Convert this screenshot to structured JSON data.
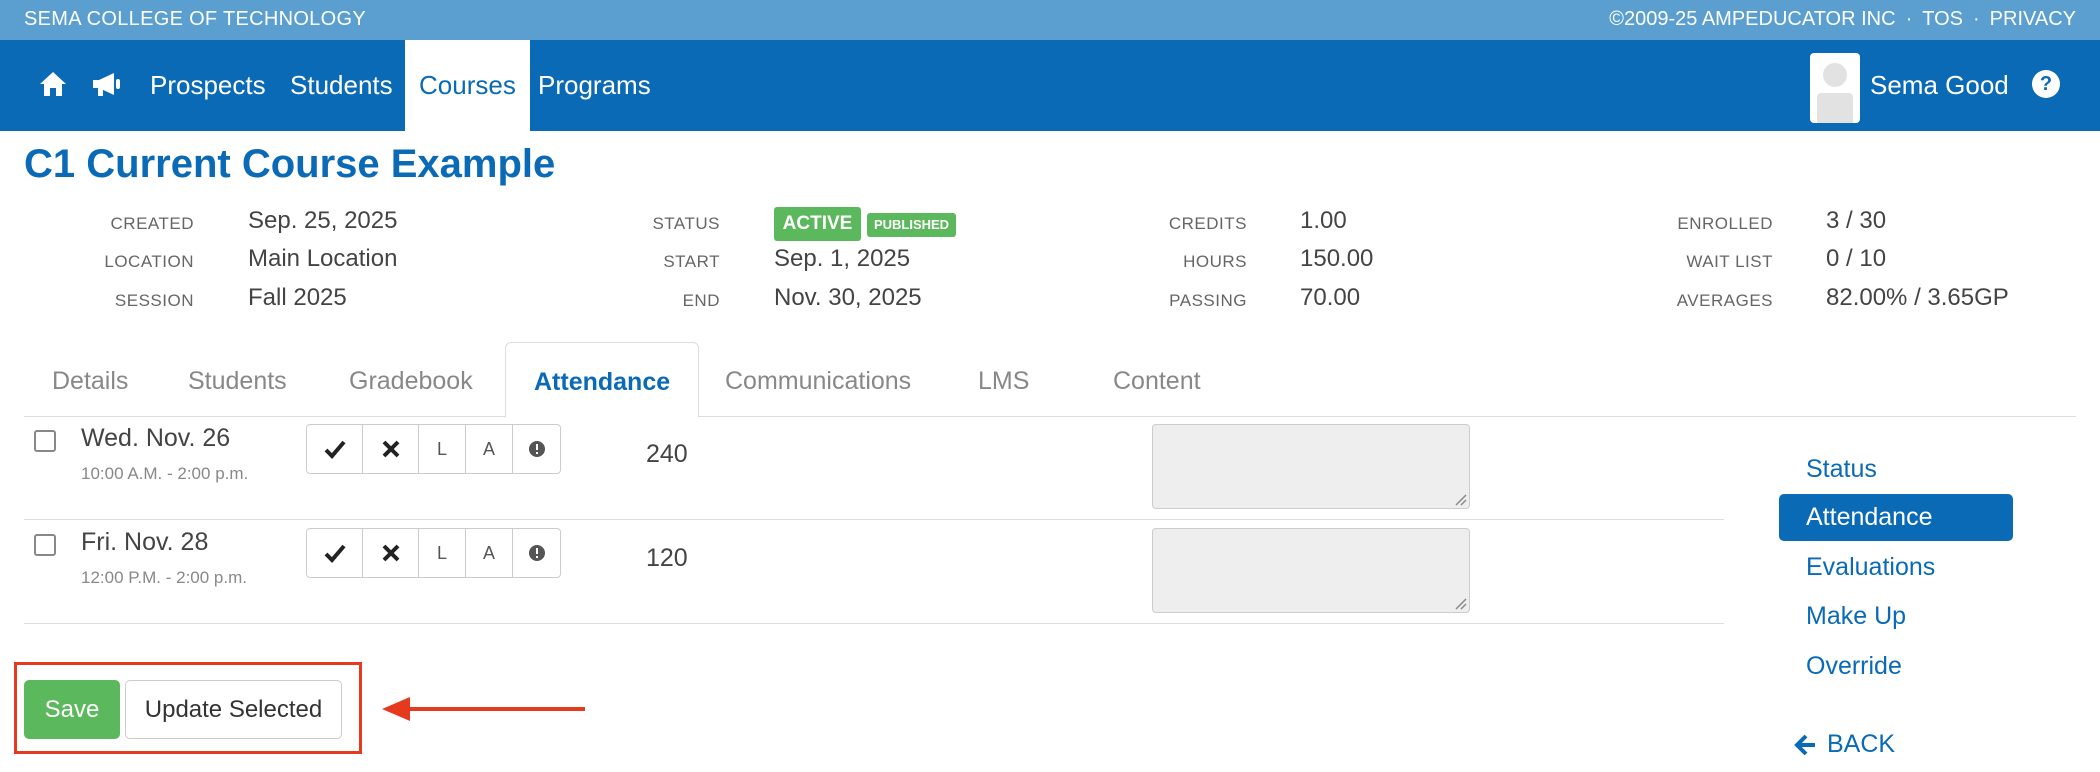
{
  "topstrip": {
    "school": "SEMA COLLEGE OF TECHNOLOGY",
    "copyright": "©2009-25 AMPEDUCATOR INC",
    "sep": "·",
    "tos": "TOS",
    "privacy": "PRIVACY"
  },
  "nav": {
    "home_icon": "home-icon",
    "announce_icon": "megaphone-icon",
    "links": [
      "Prospects",
      "Students",
      "Courses",
      "Programs"
    ],
    "active": "Courses",
    "user": "Sema Good",
    "help_icon": "question-circle-icon",
    "help_glyph": "?"
  },
  "course": {
    "title": "C1 Current Course Example",
    "meta": {
      "created_label": "CREATED",
      "created": "Sep. 25, 2025",
      "location_label": "LOCATION",
      "location": "Main Location",
      "session_label": "SESSION",
      "session": "Fall 2025",
      "status_label": "STATUS",
      "status_active": "ACTIVE",
      "status_published": "PUBLISHED",
      "start_label": "START",
      "start": "Sep. 1, 2025",
      "end_label": "END",
      "end": "Nov. 30, 2025",
      "credits_label": "CREDITS",
      "credits": "1.00",
      "hours_label": "HOURS",
      "hours": "150.00",
      "passing_label": "PASSING",
      "passing": "70.00",
      "enrolled_label": "ENROLLED",
      "enrolled": "3 / 30",
      "waitlist_label": "WAIT LIST",
      "waitlist": "0 / 10",
      "averages_label": "AVERAGES",
      "averages": "82.00% / 3.65GP"
    }
  },
  "tabs": [
    "Details",
    "Students",
    "Gradebook",
    "Attendance",
    "Communications",
    "LMS",
    "Content"
  ],
  "active_tab": "Attendance",
  "rows": [
    {
      "date": "Wed. Nov. 26",
      "time": "10:00 A.M. - 2:00 p.m.",
      "minutes": "240",
      "notes": ""
    },
    {
      "date": "Fri. Nov. 28",
      "time": "12:00 P.M. - 2:00 p.m.",
      "minutes": "120",
      "notes": ""
    }
  ],
  "attendance_buttons": {
    "present_icon": "check-icon",
    "absent_icon": "x-icon",
    "late": "L",
    "a": "A",
    "excused_icon": "exclamation-circle-icon"
  },
  "side_menu": {
    "items": [
      "Status",
      "Attendance",
      "Evaluations",
      "Make Up",
      "Override"
    ],
    "active": "Attendance",
    "back": "BACK"
  },
  "actions": {
    "save": "Save",
    "update_selected": "Update Selected"
  },
  "colors": {
    "brand": "#0a6ab6",
    "topstrip": "#5a9fd0",
    "success": "#5cb85c",
    "highlight": "#e63a1e"
  }
}
